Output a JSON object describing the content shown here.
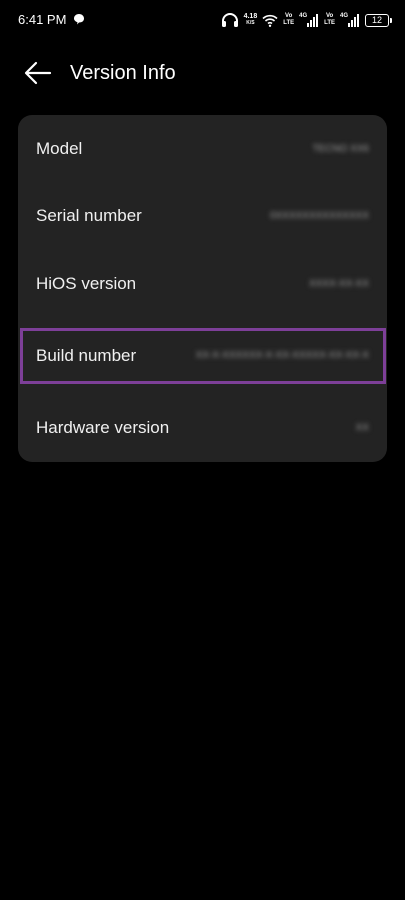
{
  "status_bar": {
    "time": "6:41 PM",
    "net_speed_value": "4.18",
    "net_speed_unit": "K/S",
    "volte_1_top": "Vo",
    "volte_1_bottom": "LTE",
    "sim1_type": "4G",
    "volte_2_top": "Vo",
    "volte_2_bottom": "LTE",
    "sim2_type": "4G",
    "battery_level": "12"
  },
  "header": {
    "title": "Version Info"
  },
  "version_info": {
    "rows": [
      {
        "label": "Model",
        "value": "TECNO XX6"
      },
      {
        "label": "Serial number",
        "value": "0XXXXXXXXXXXXXX"
      },
      {
        "label": "HiOS version",
        "value": "XXXX-XX-XX"
      },
      {
        "label": "Build number",
        "value": "XX-X-XXXXXX-X-XX-XXXXX-XX-XX-X"
      },
      {
        "label": "Hardware version",
        "value": "XX"
      }
    ]
  },
  "colors": {
    "background": "#000000",
    "card": "#232323",
    "highlight": "#7d3f98"
  }
}
